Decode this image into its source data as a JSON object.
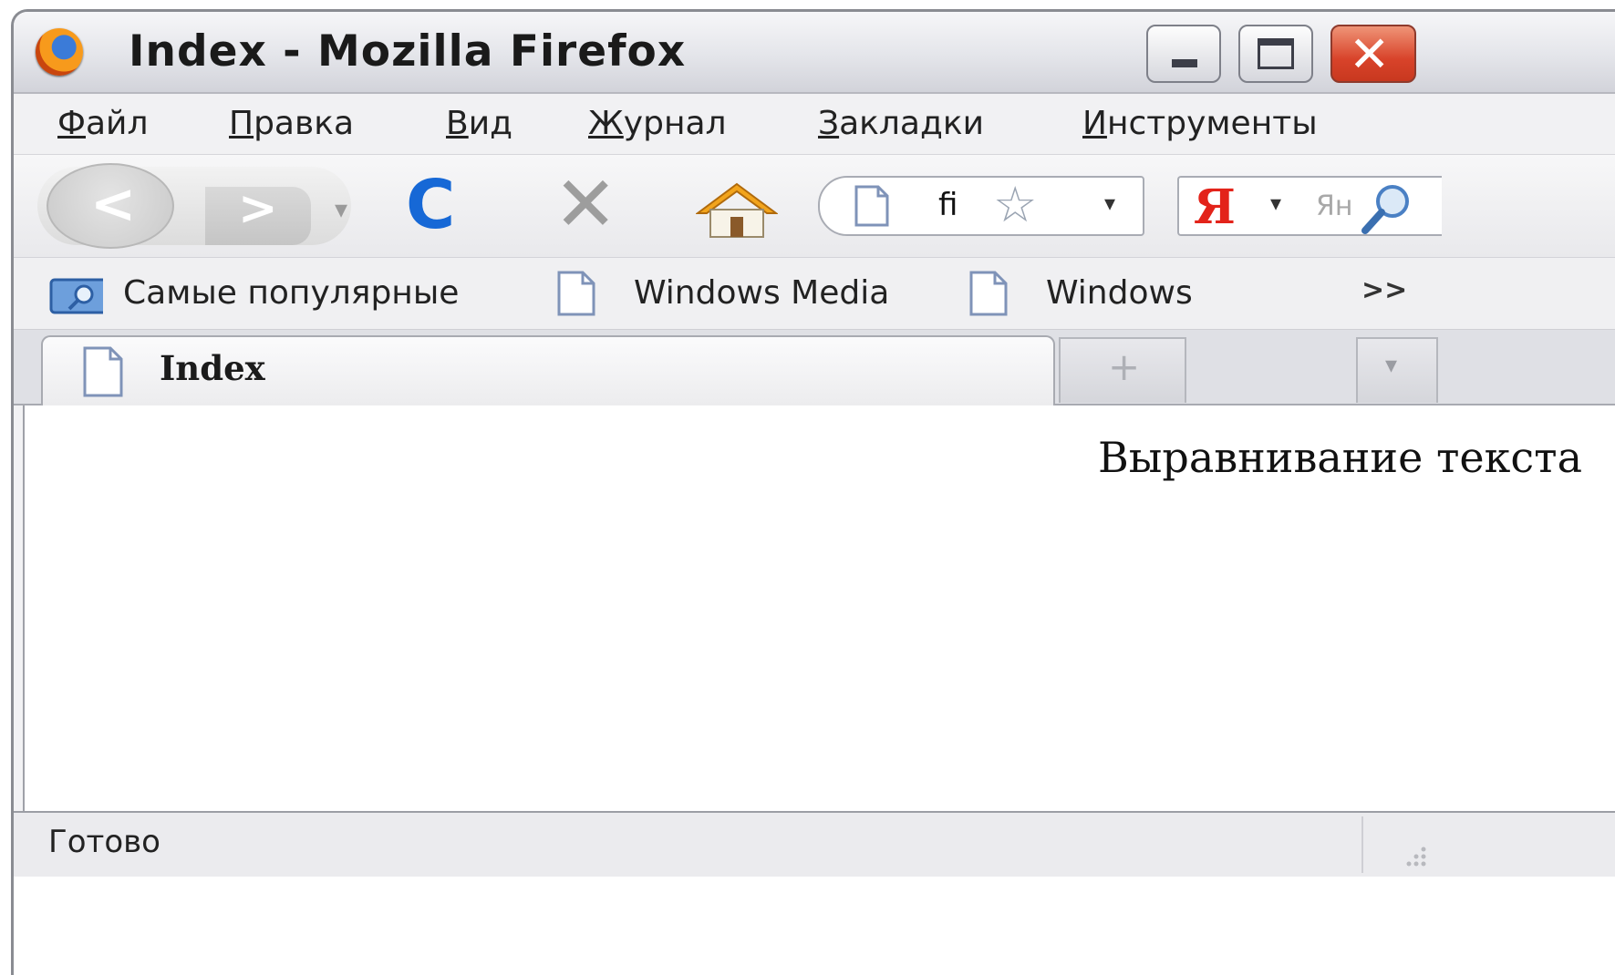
{
  "window": {
    "title": "Index - Mozilla Firefox",
    "controls": {
      "minimize": "minimize",
      "maximize": "maximize",
      "close": "close"
    }
  },
  "menubar": {
    "items": [
      {
        "prefix": "",
        "accel": "Ф",
        "rest": "айл"
      },
      {
        "prefix": "",
        "accel": "П",
        "rest": "равка"
      },
      {
        "prefix": "",
        "accel": "В",
        "rest": "ид"
      },
      {
        "prefix": "",
        "accel": "Ж",
        "rest": "урнал"
      },
      {
        "prefix": "",
        "accel": "З",
        "rest": "акладки"
      },
      {
        "prefix": "",
        "accel": "И",
        "rest": "нструменты"
      }
    ]
  },
  "navbar": {
    "back_glyph": "<",
    "forward_glyph": ">",
    "history_drop_glyph": "▾",
    "reload_glyph": "C",
    "stop_glyph": "✕",
    "url_text": "fi",
    "url_star_glyph": "☆",
    "url_drop_glyph": "▾",
    "search_engine_glyph": "Я",
    "search_drop_glyph": "▾",
    "search_placeholder": "Ян",
    "accent": "#1668d6",
    "search_brand": "#e3231a"
  },
  "bookmarks": {
    "items": [
      {
        "label": "Самые популярные",
        "icon": "smart-bookmark-icon"
      },
      {
        "label": "Windows Media",
        "icon": "page-icon"
      },
      {
        "label": "Windows",
        "icon": "page-icon"
      }
    ],
    "more_glyph": ">>"
  },
  "tabs": {
    "active_title": "Index",
    "new_tab_glyph": "+",
    "list_glyph": "▾"
  },
  "content": {
    "text": "Выравнивание текста"
  },
  "statusbar": {
    "text": "Готово"
  }
}
